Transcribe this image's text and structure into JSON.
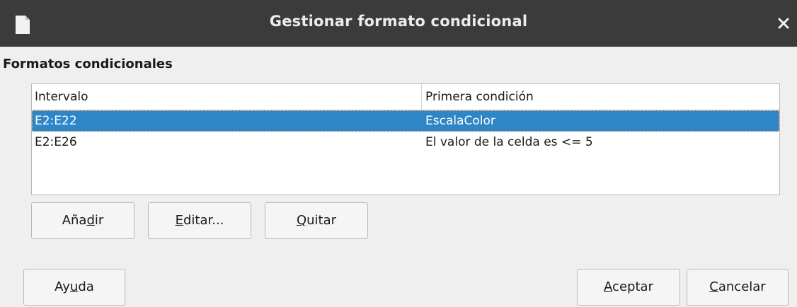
{
  "window": {
    "title": "Gestionar formato condicional",
    "icon": "document-icon",
    "close_icon": "close-icon"
  },
  "section": {
    "title": "Formatos condicionales"
  },
  "list": {
    "columns": [
      "Intervalo",
      "Primera condición"
    ],
    "rows": [
      {
        "range": "E2:E22",
        "condition": "EscalaColor",
        "selected": true
      },
      {
        "range": "E2:E26",
        "condition": "El valor de la celda es <= 5",
        "selected": false
      }
    ],
    "selection_color": "#2f86c6"
  },
  "buttons": {
    "add": {
      "pre": "Aña",
      "mnemonic": "d",
      "post": "ir"
    },
    "edit": {
      "pre": "",
      "mnemonic": "E",
      "post": "ditar..."
    },
    "remove": {
      "pre": "",
      "mnemonic": "Q",
      "post": "uitar"
    },
    "help": {
      "pre": "Ay",
      "mnemonic": "u",
      "post": "da"
    },
    "ok": {
      "pre": "",
      "mnemonic": "A",
      "post": "ceptar"
    },
    "cancel": {
      "pre": "",
      "mnemonic": "C",
      "post": "ancelar"
    }
  }
}
